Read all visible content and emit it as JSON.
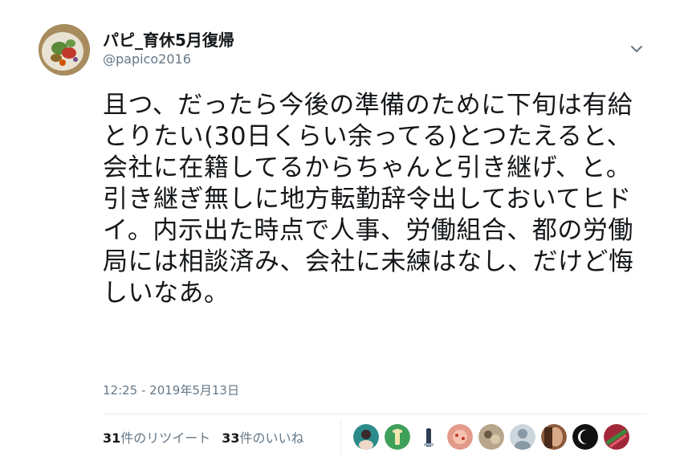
{
  "author": {
    "display_name": "パピ_育休5月復帰",
    "handle": "@papico2016",
    "avatar_icon": "food-plate-avatar-icon"
  },
  "menu": {
    "icon": "chevron-down-icon"
  },
  "tweet": {
    "text": "且つ、だったら今後の準備のために下旬は有給とりたい(30日くらい余ってる)とつたえると、会社に在籍してるからちゃんと引き継げ、と。引き継ぎ無しに地方転勤辞令出しておいてヒドイ。内示出た時点で人事、労働組合、都の労働局には相談済み、会社に未練はなし、だけど悔しいなあ。",
    "timestamp": "12:25 - 2019年5月13日"
  },
  "stats": {
    "retweet_count": "31",
    "retweet_label": "件のリツイート",
    "like_count": "33",
    "like_label": "件のいいね"
  },
  "likers": [
    {
      "name": "liker-avatar-1",
      "color": "#2b8a8a"
    },
    {
      "name": "liker-avatar-2",
      "color": "#3fa05a"
    },
    {
      "name": "liker-avatar-3",
      "color": "#ffffff"
    },
    {
      "name": "liker-avatar-4",
      "color": "#e39a8a"
    },
    {
      "name": "liker-avatar-5",
      "color": "#b7a58c"
    },
    {
      "name": "liker-avatar-6",
      "color": "#ccd6dd"
    },
    {
      "name": "liker-avatar-7",
      "color": "#8a5a3a"
    },
    {
      "name": "liker-avatar-8",
      "color": "#111111"
    },
    {
      "name": "liker-avatar-9",
      "color": "#a3273a"
    }
  ],
  "colors": {
    "text": "#14171a",
    "secondary": "#657786",
    "divider": "#e6ecf0"
  }
}
